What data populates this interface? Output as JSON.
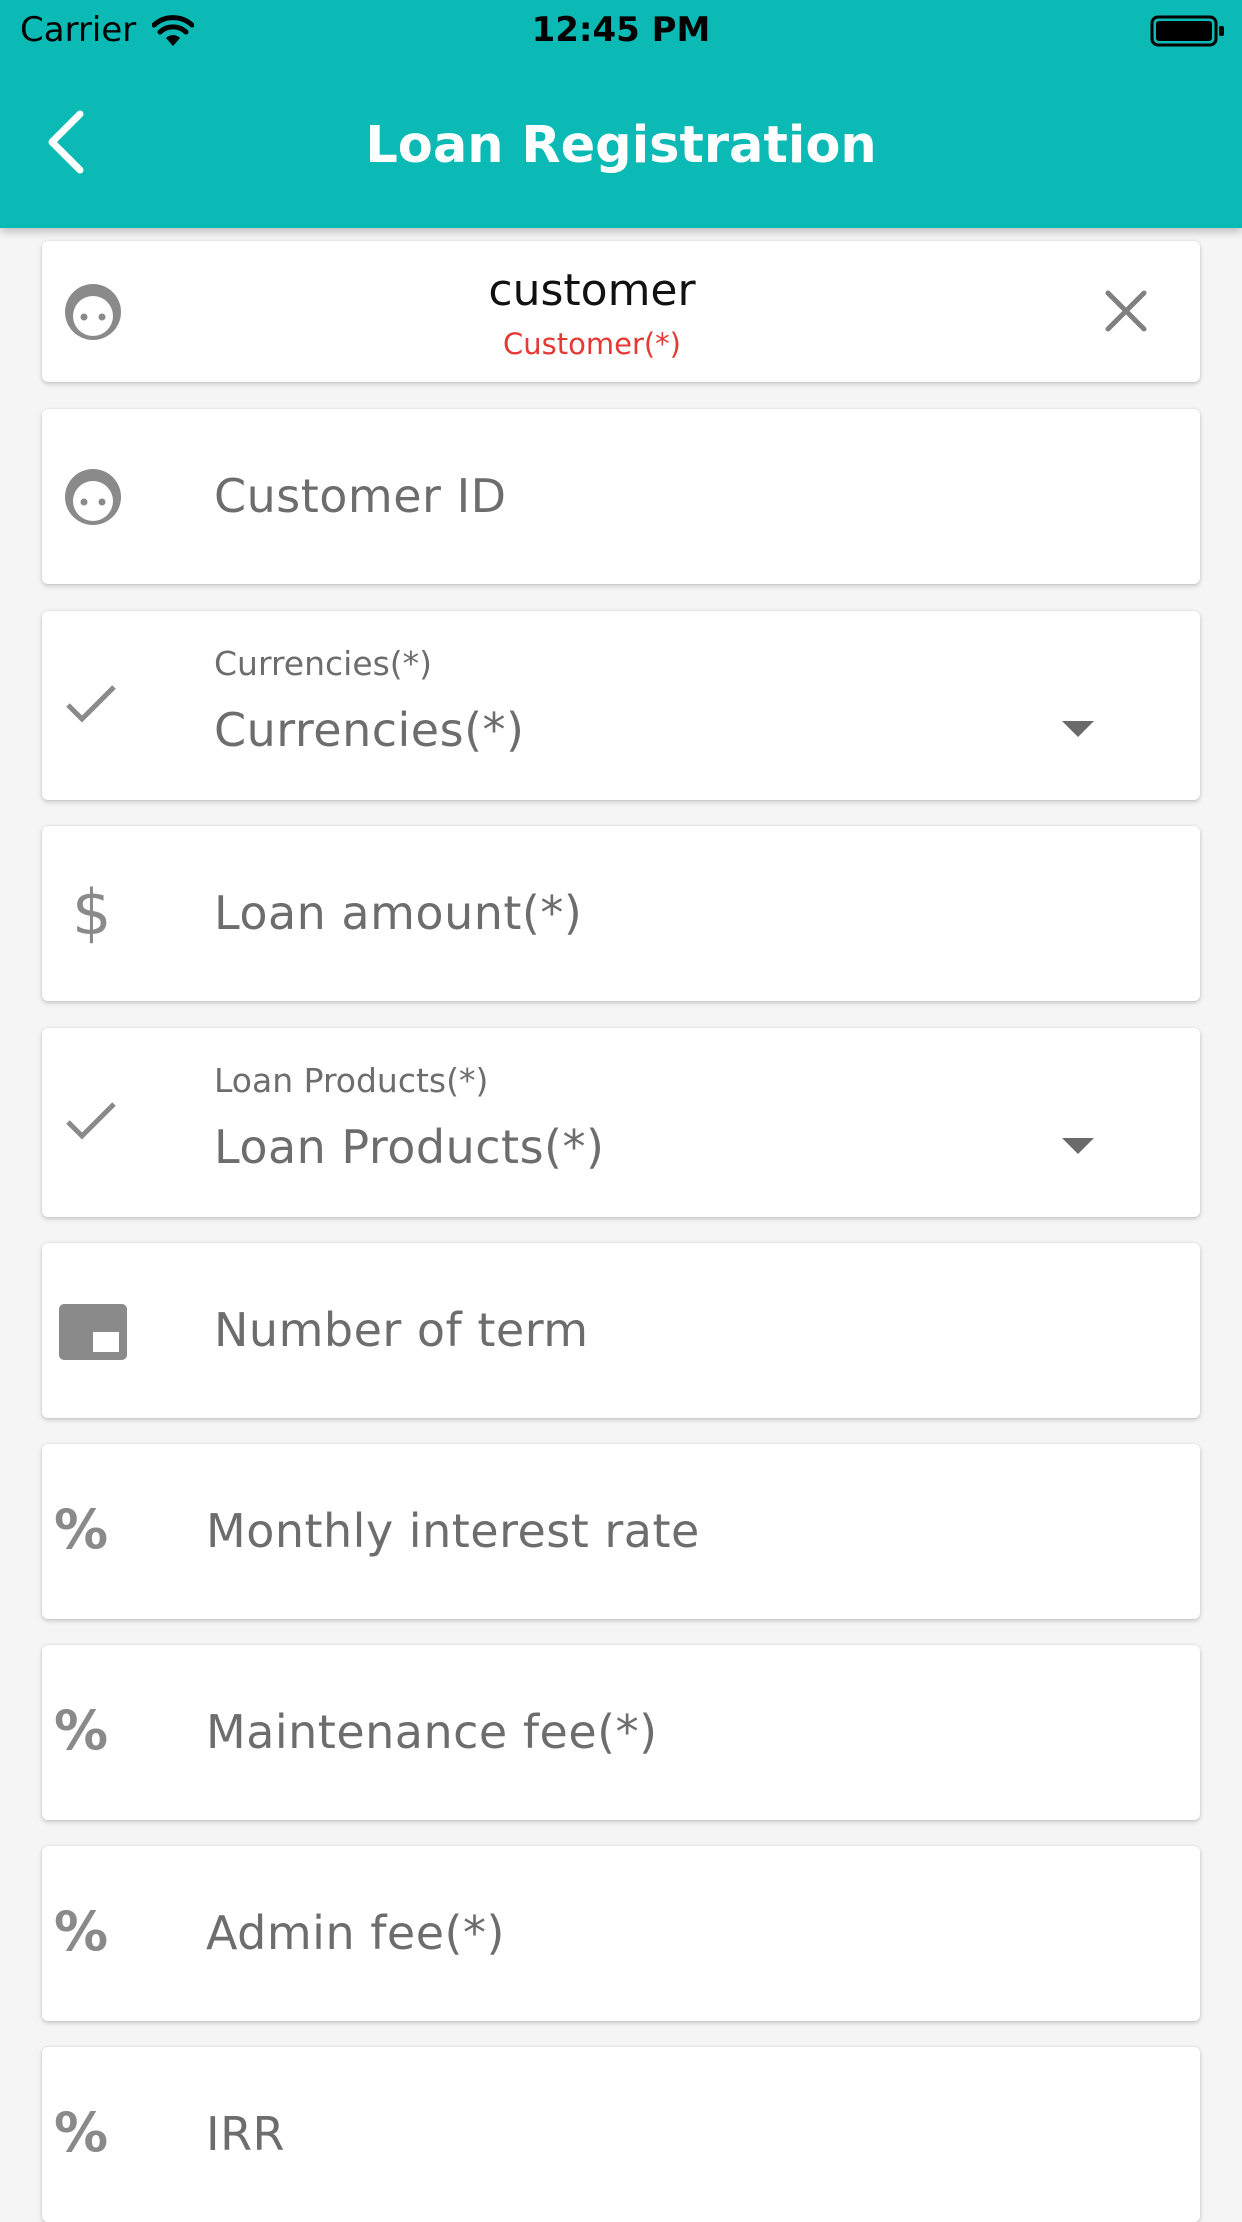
{
  "status_bar": {
    "carrier": "Carrier",
    "time": "12:45 PM"
  },
  "header": {
    "title": "Loan Registration"
  },
  "customer_card": {
    "value": "customer",
    "error_label": "Customer(*)"
  },
  "fields": {
    "customer_id": {
      "placeholder": "Customer ID"
    },
    "currencies": {
      "label": "Currencies(*)",
      "value": "Currencies(*)"
    },
    "loan_amount": {
      "placeholder": "Loan amount(*)"
    },
    "loan_products": {
      "label": "Loan Products(*)",
      "value": "Loan Products(*)"
    },
    "number_of_term": {
      "placeholder": "Number of term"
    },
    "monthly_interest_rate": {
      "placeholder": "Monthly interest rate"
    },
    "maintenance_fee": {
      "placeholder": "Maintenance fee(*)"
    },
    "admin_fee": {
      "placeholder": "Admin fee(*)"
    },
    "irr": {
      "placeholder": "IRR"
    }
  },
  "icons": {
    "percent_symbol": "%",
    "dollar_symbol": "$"
  },
  "colors": {
    "primary": "#0cbab5",
    "error": "#e53935",
    "icon_gray": "#8a8a8a"
  }
}
